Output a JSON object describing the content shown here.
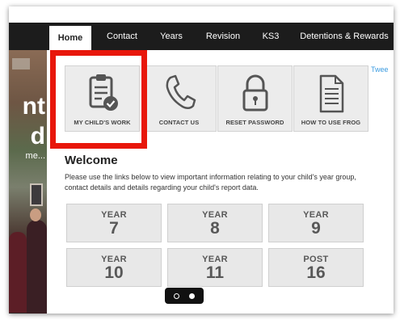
{
  "nav": {
    "tabs": [
      {
        "label": "Home",
        "active": true
      },
      {
        "label": "Contact",
        "active": false
      },
      {
        "label": "Years",
        "active": false
      },
      {
        "label": "Revision",
        "active": false
      },
      {
        "label": "KS3",
        "active": false
      },
      {
        "label": "Detentions & Rewards",
        "active": false
      }
    ]
  },
  "hero": {
    "overlay_line1": "nt",
    "overlay_line2": "d",
    "overlay_line3": "me..."
  },
  "quick_links": [
    {
      "label": "MY CHILD'S WORK",
      "icon": "clipboard-check-icon",
      "highlighted": true
    },
    {
      "label": "CONTACT US",
      "icon": "phone-icon",
      "highlighted": false
    },
    {
      "label": "RESET PASSWORD",
      "icon": "padlock-icon",
      "highlighted": false
    },
    {
      "label": "HOW TO USE FROG",
      "icon": "document-icon",
      "highlighted": false
    }
  ],
  "tweet_text": "Twee",
  "welcome": {
    "title": "Welcome",
    "body": "Please use the links below to view important information relating to your child's year group, contact details and details regarding your child's report data."
  },
  "year_tiles": [
    {
      "word": "YEAR",
      "number": "7"
    },
    {
      "word": "YEAR",
      "number": "8"
    },
    {
      "word": "YEAR",
      "number": "9"
    },
    {
      "word": "YEAR",
      "number": "10"
    },
    {
      "word": "YEAR",
      "number": "11"
    },
    {
      "word": "POST",
      "number": "16"
    }
  ],
  "carousel": {
    "slides": 2,
    "active_index": 0
  },
  "colors": {
    "nav_bg": "#1c1c1c",
    "highlight": "#e8170b",
    "tile_bg": "#ececec",
    "tile_text": "#585858",
    "link_blue": "#3b9be0"
  }
}
